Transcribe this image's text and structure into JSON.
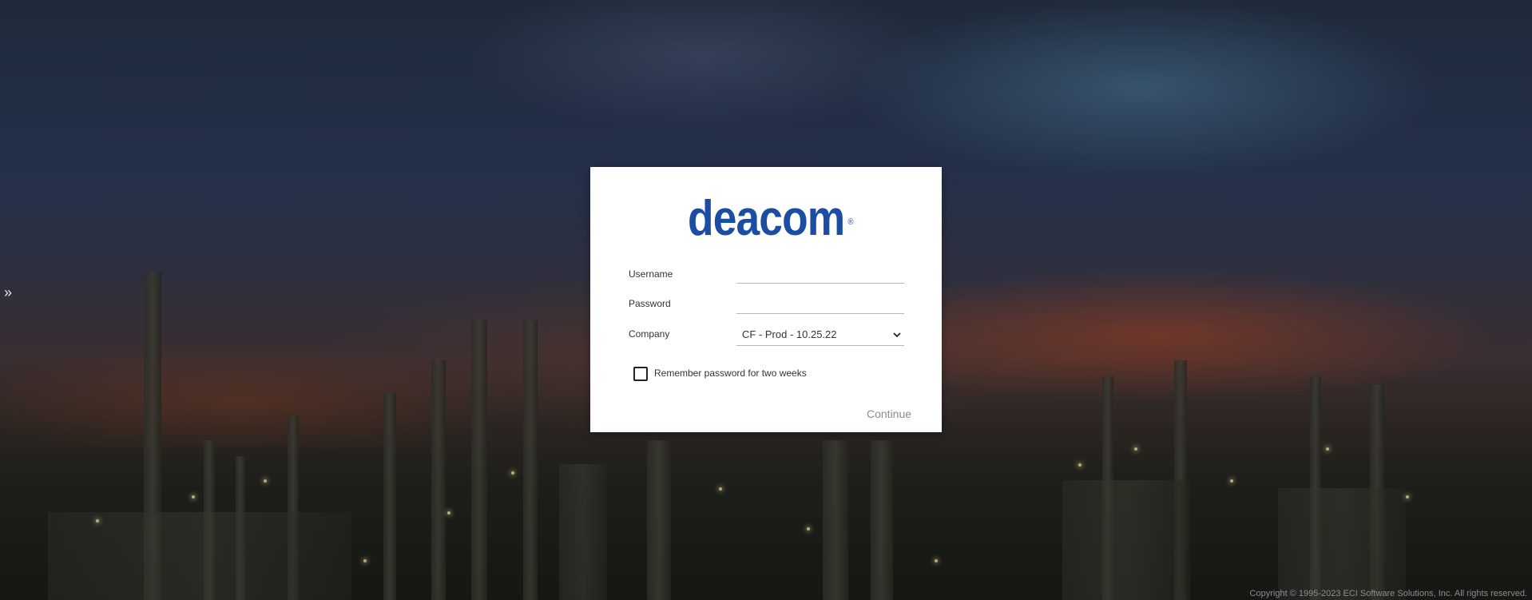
{
  "brand": {
    "logo_text": "deacom",
    "logo_registered": "®",
    "color": "#1b4ea3"
  },
  "login": {
    "username_label": "Username",
    "username_value": "",
    "password_label": "Password",
    "password_value": "",
    "company_label": "Company",
    "company_selected": "CF - Prod - 10.25.22",
    "remember_label": "Remember password for two weeks",
    "remember_checked": false,
    "continue_label": "Continue"
  },
  "sidebar": {
    "toggle_icon": "double-chevron-right-icon",
    "toggle_glyph": "»"
  },
  "footer": {
    "copyright": "Copyright © 1995-2023 ECI Software Solutions, Inc. All rights reserved."
  }
}
